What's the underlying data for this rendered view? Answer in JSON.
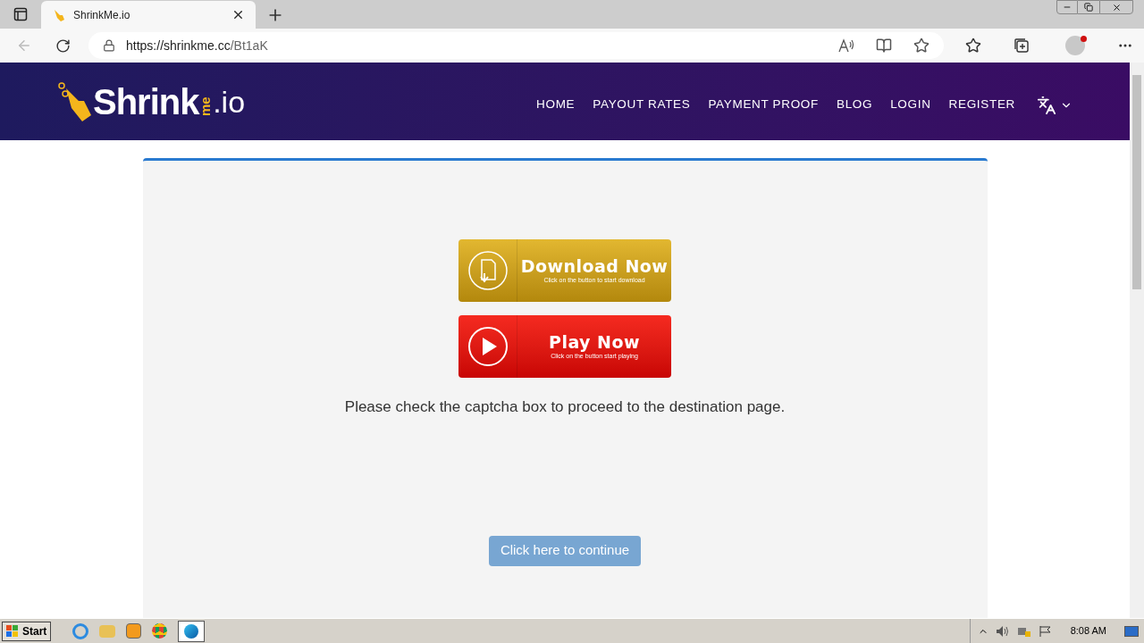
{
  "browser": {
    "tab": {
      "title": "ShrinkMe.io",
      "selected": true
    },
    "url": {
      "host": "https://shrinkme.cc",
      "path": "/Bt1aK"
    }
  },
  "site": {
    "logo": {
      "main": "Shrink",
      "small": "me",
      "suffix": ".io"
    },
    "nav": [
      {
        "label": "HOME"
      },
      {
        "label": "PAYOUT RATES"
      },
      {
        "label": "PAYMENT PROOF"
      },
      {
        "label": "BLOG"
      },
      {
        "label": "LOGIN"
      },
      {
        "label": "REGISTER"
      }
    ]
  },
  "content": {
    "ads": [
      {
        "kind": "download",
        "title": "Download Now",
        "subtitle": "Click on the button to start download"
      },
      {
        "kind": "play",
        "title": "Play Now",
        "subtitle": "Click on the button start playing"
      }
    ],
    "message": "Please check the captcha box to proceed to the destination page.",
    "continue_button": "Click here to continue"
  },
  "taskbar": {
    "start": "Start",
    "clock": "8:08 AM"
  }
}
